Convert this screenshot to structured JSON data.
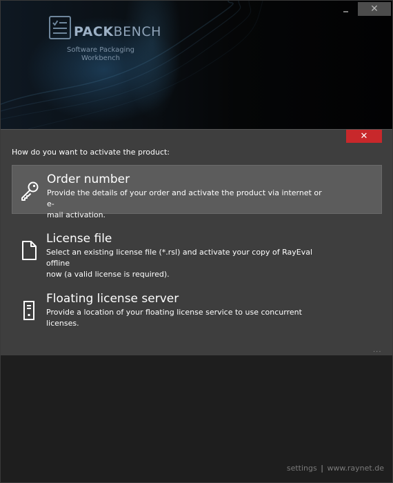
{
  "brand": {
    "name_bold": "PACK",
    "name_rest": "BENCH",
    "subtitle_line1": "Software Packaging",
    "subtitle_line2": "Workbench"
  },
  "window_controls": {
    "minimize_icon": "minimize-icon",
    "close_icon": "close-icon",
    "close_glyph": "✕"
  },
  "dialog": {
    "close_glyph": "✕",
    "question": "How do you want to activate the product:",
    "options": [
      {
        "title": "Order number",
        "desc_line1": "Provide the details of your order and activate the product via internet or e-",
        "desc_line2": "mail activation.",
        "icon": "key-icon",
        "selected": true
      },
      {
        "title": "License file",
        "desc_line1": "Select an existing license file (*.rsl) and activate your copy of RayEval offline",
        "desc_line2": "now (a valid license is required).",
        "icon": "file-icon",
        "selected": false
      },
      {
        "title": "Floating license server",
        "desc_line1": "Provide a location of your floating license service to use concurrent",
        "desc_line2": "licenses.",
        "icon": "server-icon",
        "selected": false
      }
    ],
    "more": "..."
  },
  "footer": {
    "settings": "settings",
    "separator": "|",
    "website": "www.raynet.de"
  },
  "colors": {
    "accent_close": "#c8282b",
    "selected_bg": "#5c5c5c",
    "dialog_bg": "#3e3e3e"
  }
}
